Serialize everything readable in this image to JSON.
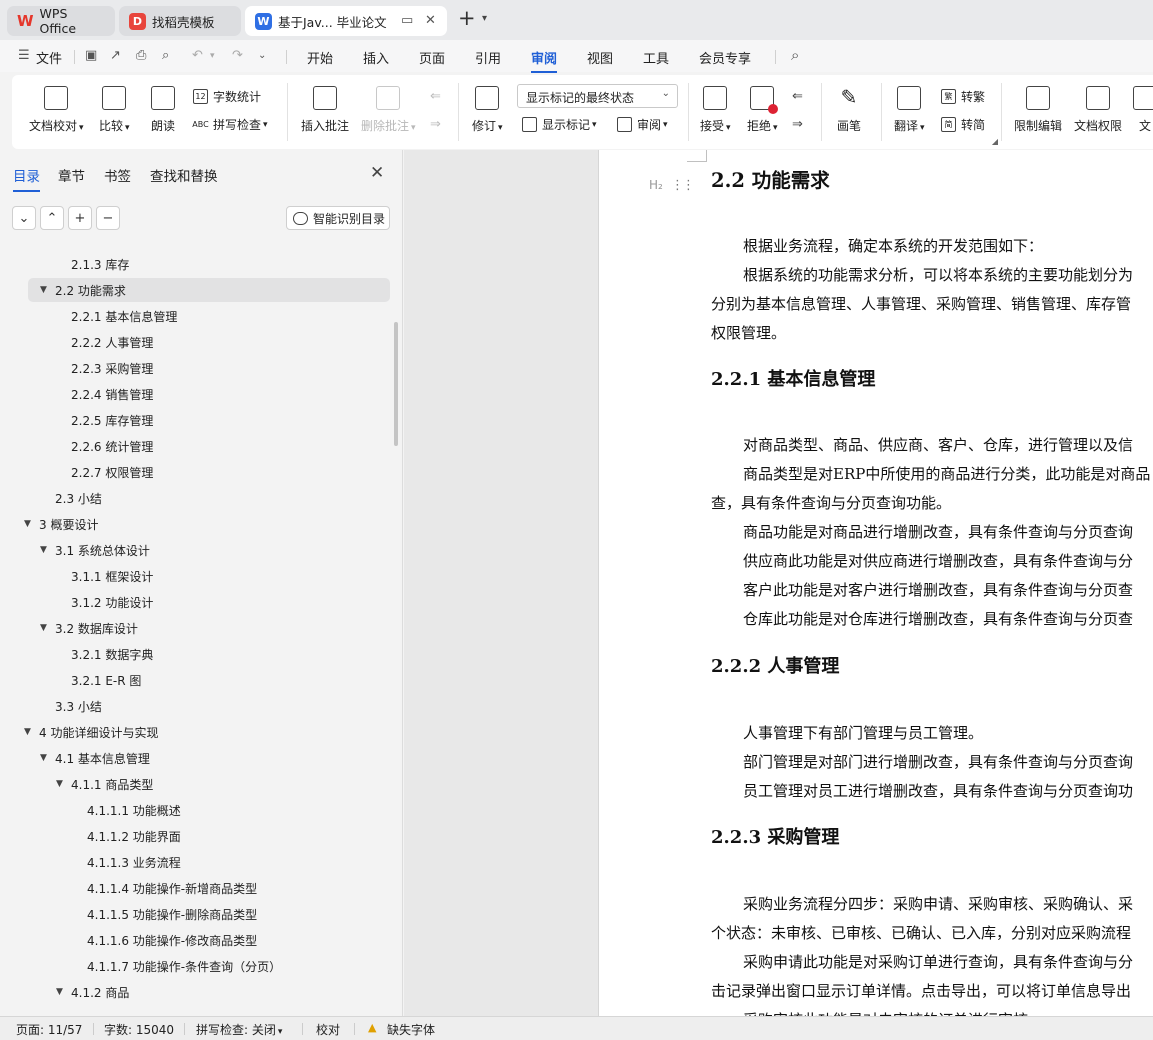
{
  "tabs": [
    {
      "label": "WPS Office",
      "icon": "wps-logo-icon"
    },
    {
      "label": "找稻壳模板",
      "icon": "docer-icon"
    },
    {
      "label": "基于Jav... 毕业论文",
      "icon": "writer-doc-icon"
    }
  ],
  "menu": {
    "file": "文件",
    "items": [
      "开始",
      "插入",
      "页面",
      "引用",
      "审阅",
      "视图",
      "工具",
      "会员专享"
    ],
    "active": "审阅"
  },
  "ribbon": {
    "doc_check": "文档校对",
    "compare": "比较",
    "read_aloud": "朗读",
    "word_count": "字数统计",
    "spell_check": "拼写检查",
    "insert_comment": "插入批注",
    "delete_comment": "删除批注",
    "track_changes": "修订",
    "markup_state": "显示标记的最终状态",
    "show_markup": "显示标记",
    "review": "审阅",
    "accept": "接受",
    "reject": "拒绝",
    "pen": "画笔",
    "translate": "翻译",
    "to_traditional": "转繁",
    "to_simplified": "转简",
    "restrict_edit": "限制编辑",
    "doc_permission": "文档权限",
    "doc_cut": "文"
  },
  "nav": {
    "tabs": [
      "目录",
      "章节",
      "书签",
      "查找和替换"
    ],
    "smart_toc": "智能识别目录",
    "toc": [
      {
        "label": "2.1.3  库存",
        "level": 3,
        "tri": false
      },
      {
        "label": "2.2  功能需求",
        "level": 2,
        "tri": true,
        "selected": true
      },
      {
        "label": "2.2.1 基本信息管理",
        "level": 3,
        "tri": false
      },
      {
        "label": "2.2.2 人事管理",
        "level": 3,
        "tri": false
      },
      {
        "label": "2.2.3 采购管理",
        "level": 3,
        "tri": false
      },
      {
        "label": "2.2.4 销售管理",
        "level": 3,
        "tri": false
      },
      {
        "label": "2.2.5 库存管理",
        "level": 3,
        "tri": false
      },
      {
        "label": "2.2.6 统计管理",
        "level": 3,
        "tri": false
      },
      {
        "label": "2.2.7 权限管理",
        "level": 3,
        "tri": false
      },
      {
        "label": "2.3  小结",
        "level": 2,
        "tri": false
      },
      {
        "label": "3  概要设计",
        "level": 1,
        "tri": true
      },
      {
        "label": "3.1 系统总体设计",
        "level": 2,
        "tri": true
      },
      {
        "label": "3.1.1  框架设计",
        "level": 3,
        "tri": false
      },
      {
        "label": "3.1.2  功能设计",
        "level": 3,
        "tri": false
      },
      {
        "label": "3.2  数据库设计",
        "level": 2,
        "tri": true
      },
      {
        "label": "3.2.1 数据字典",
        "level": 3,
        "tri": false
      },
      {
        "label": "3.2.1 E-R 图",
        "level": 3,
        "tri": false
      },
      {
        "label": "3.3  小结",
        "level": 2,
        "tri": false
      },
      {
        "label": "4  功能详细设计与实现",
        "level": 1,
        "tri": true
      },
      {
        "label": "4.1 基本信息管理",
        "level": 2,
        "tri": true
      },
      {
        "label": "4.1.1 商品类型",
        "level": 3,
        "tri": true
      },
      {
        "label": "4.1.1.1 功能概述",
        "level": 4,
        "tri": false
      },
      {
        "label": "4.1.1.2 功能界面",
        "level": 4,
        "tri": false
      },
      {
        "label": "4.1.1.3 业务流程",
        "level": 4,
        "tri": false
      },
      {
        "label": "4.1.1.4 功能操作-新增商品类型",
        "level": 4,
        "tri": false
      },
      {
        "label": "4.1.1.5 功能操作-删除商品类型",
        "level": 4,
        "tri": false
      },
      {
        "label": "4.1.1.6 功能操作-修改商品类型",
        "level": 4,
        "tri": false
      },
      {
        "label": "4.1.1.7 功能操作-条件查询（分页）",
        "level": 4,
        "tri": false
      },
      {
        "label": "4.1.2 商品",
        "level": 3,
        "tri": true
      }
    ]
  },
  "document": {
    "h2_marker": "H₂",
    "lines": [
      {
        "text": "2.2  功能需求",
        "style": "h2",
        "indent": false
      },
      {
        "text": "根据业务流程，确定本系统的开发范围如下：",
        "style": "p",
        "indent": true
      },
      {
        "text": "根据系统的功能需求分析，可以将本系统的主要功能划分为",
        "style": "p",
        "indent": true
      },
      {
        "text": "分别为基本信息管理、人事管理、采购管理、销售管理、库存管",
        "style": "p",
        "indent": false
      },
      {
        "text": "权限管理。",
        "style": "p",
        "indent": false
      },
      {
        "text": "2.2.1 基本信息管理",
        "style": "h3",
        "indent": false
      },
      {
        "text": "对商品类型、商品、供应商、客户、仓库，进行管理以及信",
        "style": "p",
        "indent": true
      },
      {
        "text": "商品类型是对ERP中所使用的商品进行分类，此功能是对商品",
        "style": "p",
        "indent": true
      },
      {
        "text": "查，具有条件查询与分页查询功能。",
        "style": "p",
        "indent": false
      },
      {
        "text": "商品功能是对商品进行增删改查，具有条件查询与分页查询",
        "style": "p",
        "indent": true
      },
      {
        "text": "供应商此功能是对供应商进行增删改查，具有条件查询与分",
        "style": "p",
        "indent": true
      },
      {
        "text": "客户此功能是对客户进行增删改查，具有条件查询与分页查",
        "style": "p",
        "indent": true
      },
      {
        "text": "仓库此功能是对仓库进行增删改查，具有条件查询与分页查",
        "style": "p",
        "indent": true
      },
      {
        "text": "2.2.2 人事管理",
        "style": "h3",
        "indent": false
      },
      {
        "text": "人事管理下有部门管理与员工管理。",
        "style": "p",
        "indent": true
      },
      {
        "text": "部门管理是对部门进行增删改查，具有条件查询与分页查询",
        "style": "p",
        "indent": true
      },
      {
        "text": "员工管理对员工进行增删改查，具有条件查询与分页查询功",
        "style": "p",
        "indent": true
      },
      {
        "text": "2.2.3 采购管理",
        "style": "h3",
        "indent": false
      },
      {
        "text": "采购业务流程分四步：采购申请、采购审核、采购确认、采",
        "style": "p",
        "indent": true
      },
      {
        "text": "个状态：未审核、已审核、已确认、已入库，分别对应采购流程",
        "style": "p",
        "indent": false
      },
      {
        "text": "采购申请此功能是对采购订单进行查询，具有条件查询与分",
        "style": "p",
        "indent": true
      },
      {
        "text": "击记录弹出窗口显示订单详情。点击导出，可以将订单信息导出",
        "style": "p",
        "indent": false
      },
      {
        "text": "采购审核此功能是对未审核的订单进行审核",
        "style": "p",
        "indent": true
      }
    ]
  },
  "status": {
    "page": "页面: 11/57",
    "words": "字数: 15040",
    "spell": "拼写检查: 关闭",
    "proof": "校对",
    "missing_font": "缺失字体"
  }
}
